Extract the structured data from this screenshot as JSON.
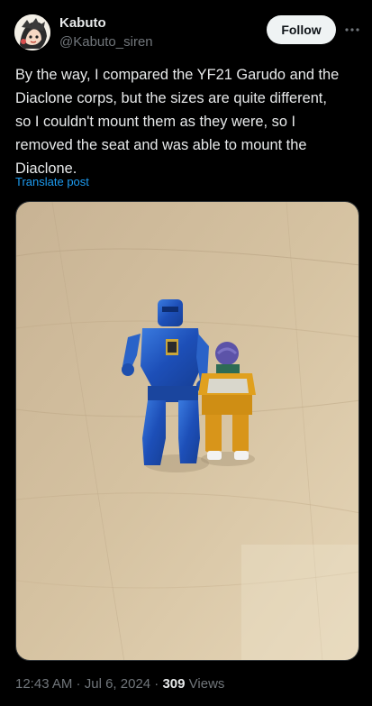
{
  "author": {
    "name": "Kabuto",
    "handle": "@Kabuto_siren"
  },
  "actions": {
    "follow_label": "Follow",
    "more_icon": "more-dots-icon"
  },
  "post": {
    "text": "By the way, I compared the YF21 Garudo and the\nDiaclone corps, but the sizes are quite different,\nso I couldn't mount them as they were, so I\nremoved the seat and was able to mount the\nDiaclone.",
    "translate_label": "Translate post"
  },
  "media": {
    "subject": "two-action-figures-photo"
  },
  "meta": {
    "time": "12:43 AM",
    "separator": " · ",
    "date": "Jul 6, 2024",
    "views_count": "309",
    "views_label": "Views"
  }
}
